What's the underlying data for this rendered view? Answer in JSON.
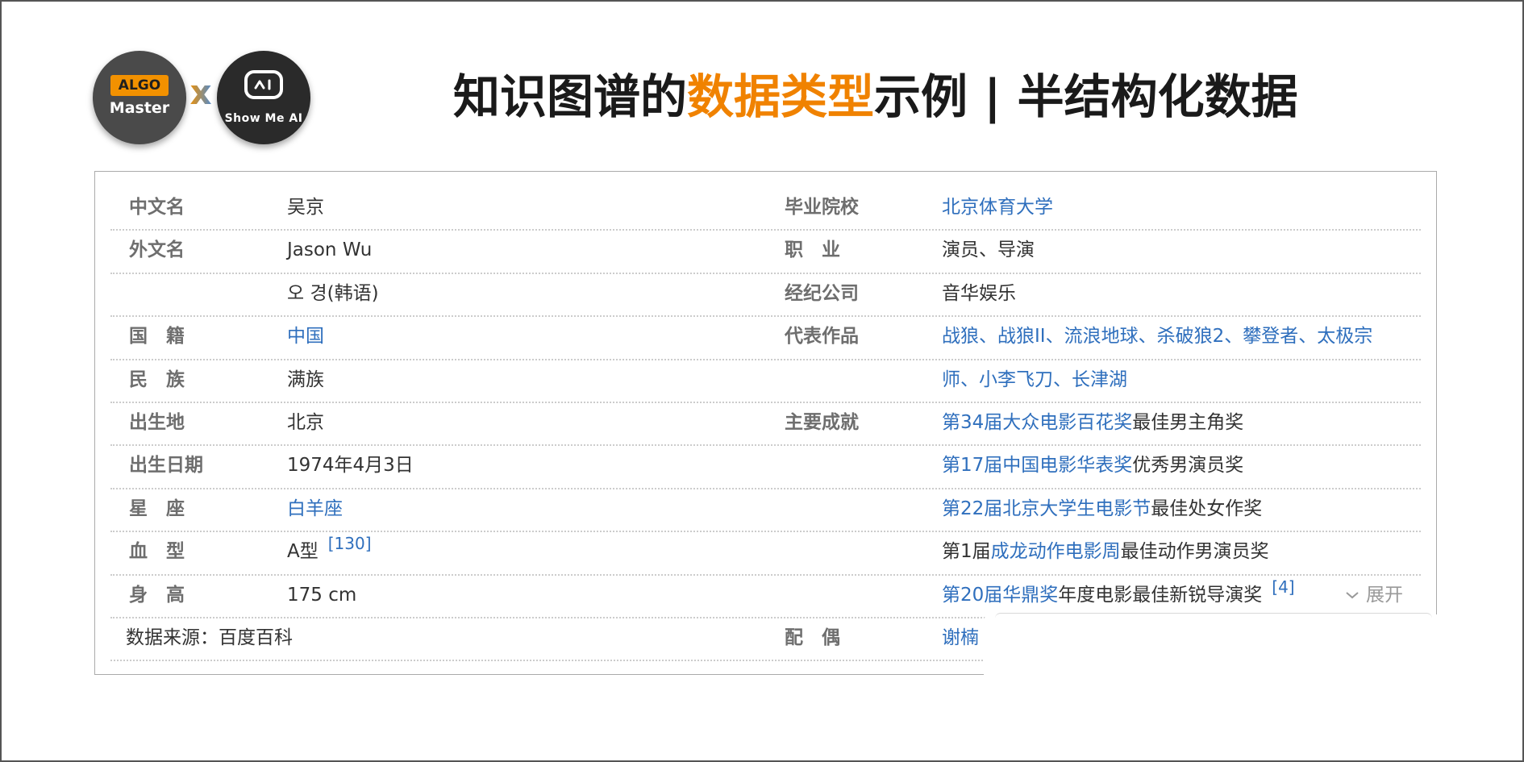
{
  "logos": {
    "left": {
      "badge": "ALGO",
      "word": "Master"
    },
    "separator": "x",
    "right": {
      "word": "Show Me AI"
    }
  },
  "title": {
    "part1": "知识图谱的",
    "highlight": "数据类型",
    "part2": "示例 | 半结构化数据",
    "highlight_color": "#f08200"
  },
  "left_rows": [
    {
      "label": "中文名",
      "value": "吴京",
      "is_link": false
    },
    {
      "label": "外文名",
      "value": "Jason Wu",
      "is_link": false
    },
    {
      "label": "",
      "value": "오 경(韩语)",
      "is_link": false
    },
    {
      "label": "国　籍",
      "value": "中国",
      "is_link": true
    },
    {
      "label": "民　族",
      "value": "满族",
      "is_link": false
    },
    {
      "label": "出生地",
      "value": "北京",
      "is_link": false
    },
    {
      "label": "出生日期",
      "value": "1974年4月3日",
      "is_link": false
    },
    {
      "label": "星　座",
      "value": "白羊座",
      "is_link": true
    },
    {
      "label": "血　型",
      "value": "A型",
      "ref": "[130]",
      "is_link": false
    },
    {
      "label": "身　高",
      "value": "175 cm",
      "is_link": false
    }
  ],
  "source_note": "数据来源：百度百科",
  "right_rows": [
    {
      "label": "毕业院校",
      "parts": [
        {
          "text": "北京体育大学",
          "link": true
        }
      ]
    },
    {
      "label": "职　业",
      "parts": [
        {
          "text": "演员、导演",
          "link": false
        }
      ]
    },
    {
      "label": "经纪公司",
      "parts": [
        {
          "text": "音华娱乐",
          "link": false
        }
      ]
    },
    {
      "label": "代表作品",
      "parts": [
        {
          "text": "战狼、战狼II、流浪地球、杀破狼2、攀登者、太极宗",
          "link": true
        }
      ]
    },
    {
      "label": "",
      "parts": [
        {
          "text": "师、小李飞刀、长津湖",
          "link": true
        }
      ]
    },
    {
      "label": "主要成就",
      "parts": [
        {
          "text": "第34届大众电影百花奖",
          "link": true
        },
        {
          "text": "最佳男主角奖",
          "link": false
        }
      ]
    },
    {
      "label": "",
      "parts": [
        {
          "text": "第17届中国电影华表奖",
          "link": true
        },
        {
          "text": "优秀男演员奖",
          "link": false
        }
      ]
    },
    {
      "label": "",
      "parts": [
        {
          "text": "第22届北京大学生电影节",
          "link": true
        },
        {
          "text": "最佳处女作奖",
          "link": false
        }
      ]
    },
    {
      "label": "",
      "parts": [
        {
          "text": "第1届",
          "link": false
        },
        {
          "text": "成龙动作电影周",
          "link": true
        },
        {
          "text": "最佳动作男演员奖",
          "link": false
        }
      ]
    },
    {
      "label": "",
      "parts": [
        {
          "text": "第20届华鼎奖",
          "link": true
        },
        {
          "text": "年度电影最佳新锐导演奖",
          "link": false
        }
      ],
      "ref": "[4]"
    },
    {
      "label": "配　偶",
      "parts": [
        {
          "text": "谢楠",
          "link": true
        }
      ]
    }
  ],
  "expand_label": "展开",
  "icons": {
    "expand": "chevron-down-icon",
    "robot": "robot-face-icon"
  }
}
